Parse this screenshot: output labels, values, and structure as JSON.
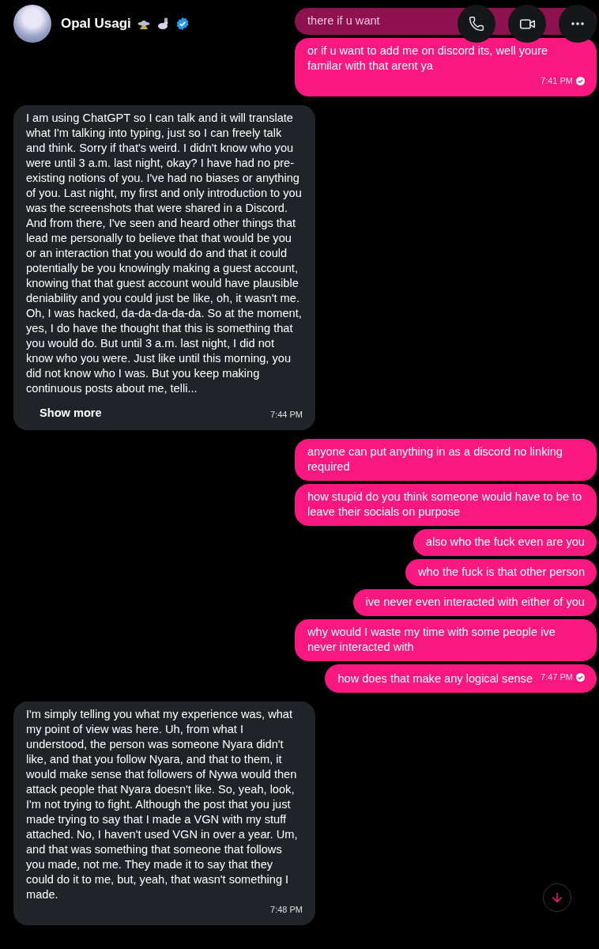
{
  "header": {
    "name": "Opal Usagi",
    "verified": true
  },
  "messages": [
    {
      "kind": "sent",
      "text": "there if u want",
      "faded": true
    },
    {
      "kind": "sent",
      "text": "or if u want to add me on discord its, well youre familar with that arent ya",
      "time": "7:41 PM",
      "read": true
    },
    {
      "kind": "received",
      "text": "I am using ChatGPT so I can talk and it will translate what I'm talking into typing, just so I can freely talk and think. Sorry if that's weird. I didn't know who you were until 3 a.m. last night, okay? I have had no pre-existing notions of you. I've had no biases or anything of you. Last night, my first and only introduction to you was the screenshots that were shared in a Discord. And from there, I've seen and heard other things that lead me personally to believe that that would be you or an interaction that you would do and that it could potentially be you knowingly making a guest account, knowing that that guest account would have plausible deniability and you could just be like, oh, it wasn't me. Oh, I was hacked, da-da-da-da-da. So at the moment, yes, I do have the thought that this is something that you would do. But until 3 a.m. last night, I did not know who you were. Just like until this morning, you did not know who I was. But you keep making continuous posts about me, telli...",
      "more": "Show more",
      "time": "7:44 PM"
    },
    {
      "kind": "sent",
      "text": "anyone can put anything in as a discord no linking required"
    },
    {
      "kind": "sent",
      "text": "how stupid do you think someone would have to be to leave their socials on purpose"
    },
    {
      "kind": "sent",
      "text": "also who the fuck even are you"
    },
    {
      "kind": "sent",
      "text": "who the fuck is that other person"
    },
    {
      "kind": "sent",
      "text": "ive never even interacted with either of you"
    },
    {
      "kind": "sent",
      "text": "why would I waste my time with some people ive never interacted with"
    },
    {
      "kind": "sent",
      "text": "how does that make any logical sense",
      "time": "7:47 PM",
      "read": true
    },
    {
      "kind": "received",
      "text": "I'm simply telling you what my experience was, what my point of view was here. Uh, from what I understood, the person was someone Nyara didn't like, and that you follow Nyara, and that to them, it would make sense that followers of Nywa would then attack people that Nyara doesn't like. So, yeah, look, I'm not trying to fight. Although the post that you just made trying to say that I made a VGN with my stuff attached. No, I haven't used VGN in over a year. Um, and that was something that someone that follows you made, not me. They made it to say that they could do it to me, but, yeah, that wasn't something I made.",
      "time": "7:48 PM"
    }
  ]
}
